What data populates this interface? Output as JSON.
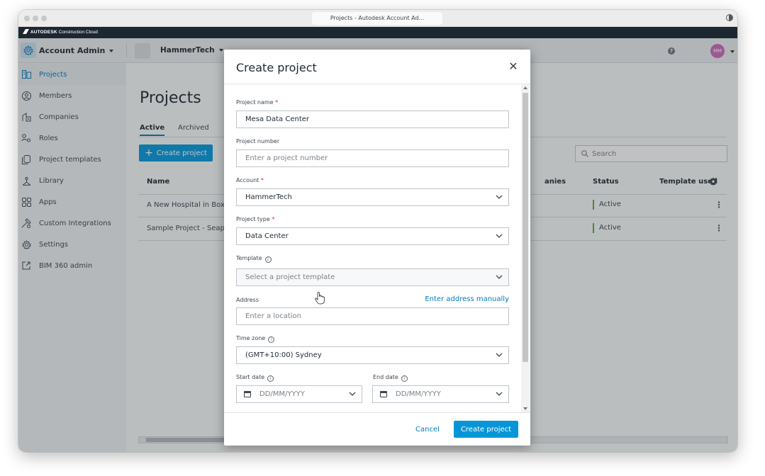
{
  "browser": {
    "tab_title": "Projects - Autodesk Account Ad..."
  },
  "brand": {
    "name_bold": "AUTODESK",
    "name_rest": " Construction Cloud"
  },
  "appbar": {
    "module": "Account Admin",
    "account": "HammerTech",
    "avatar_initials": "MM",
    "help_glyph": "?"
  },
  "sidebar": {
    "items": [
      {
        "label": "Projects",
        "icon": "projects-icon",
        "active": true
      },
      {
        "label": "Members",
        "icon": "members-icon"
      },
      {
        "label": "Companies",
        "icon": "companies-icon"
      },
      {
        "label": "Roles",
        "icon": "roles-icon"
      },
      {
        "label": "Project templates",
        "icon": "templates-icon"
      },
      {
        "label": "Library",
        "icon": "library-icon"
      },
      {
        "label": "Apps",
        "icon": "apps-icon"
      },
      {
        "label": "Custom Integrations",
        "icon": "integrations-icon"
      },
      {
        "label": "Settings",
        "icon": "settings-icon"
      },
      {
        "label": "BIM 360 admin",
        "icon": "external-link-icon"
      }
    ]
  },
  "main": {
    "title": "Projects",
    "tabs": [
      {
        "label": "Active",
        "active": true
      },
      {
        "label": "Archived"
      }
    ],
    "create_button": "Create project",
    "search_placeholder": "Search",
    "columns": {
      "name": "Name",
      "companies": "anies",
      "status": "Status",
      "template": "Template used"
    },
    "rows": [
      {
        "name": "A New Hospital in Boxh",
        "status": "Active"
      },
      {
        "name": "Sample Project - Seapo",
        "status": "Active"
      }
    ]
  },
  "modal": {
    "title": "Create project",
    "fields": {
      "project_name": {
        "label": "Project name",
        "value": "Mesa Data Center"
      },
      "project_number": {
        "label": "Project number",
        "placeholder": "Enter a project number"
      },
      "account": {
        "label": "Account",
        "value": "HammerTech"
      },
      "project_type": {
        "label": "Project type",
        "value": "Data Center"
      },
      "template": {
        "label": "Template",
        "placeholder": "Select a project template"
      },
      "address": {
        "label": "Address",
        "link": "Enter address manually",
        "placeholder": "Enter a location"
      },
      "time_zone": {
        "label": "Time zone",
        "value": "(GMT+10:00) Sydney"
      },
      "start_date": {
        "label": "Start date",
        "placeholder": "DD/MM/YYYY"
      },
      "end_date": {
        "label": "End date",
        "placeholder": "DD/MM/YYYY"
      }
    },
    "required_mark": "*",
    "info_glyph": "i",
    "cancel": "Cancel",
    "submit": "Create project"
  },
  "colors": {
    "accent": "#0696d7",
    "link": "#0679b7",
    "status_active": "#5fa537",
    "required": "#d9232e",
    "brandbar": "#1c2732"
  }
}
